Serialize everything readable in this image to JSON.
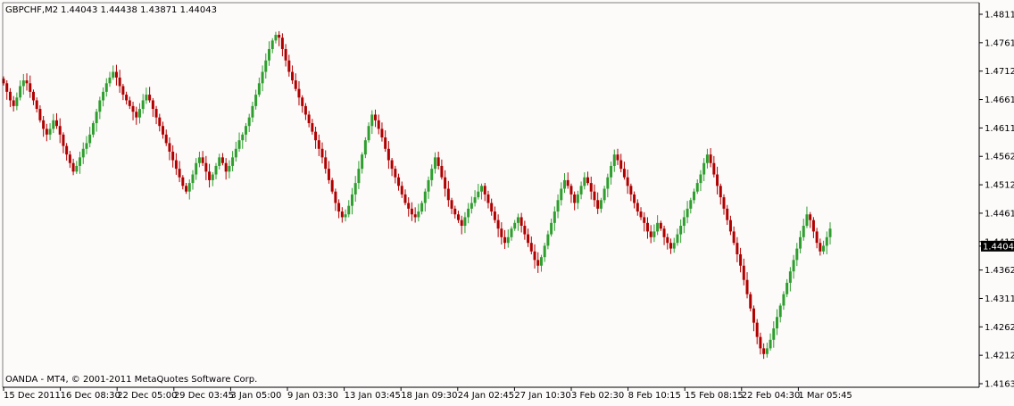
{
  "header": {
    "symbol": "GBPCHF,M2",
    "ohlc": "1.44043 1.44438 1.43871 1.44043"
  },
  "footer": {
    "copyright": "OANDA - MT4, © 2001-2011 MetaQuotes Software Corp."
  },
  "colors": {
    "background": "#fdfafa",
    "bull": "#2e9e2e",
    "bear": "#b00000",
    "axis": "#000000",
    "price_tag_bg": "#000000",
    "price_tag_fg": "#ffffff"
  },
  "chart_data": {
    "type": "candlestick",
    "title": "GBPCHF,M2",
    "last_price": "1.44043",
    "ylim": [
      1.4163,
      1.4811
    ],
    "y_ticks": [
      "1.48110",
      "1.47615",
      "1.47120",
      "1.46610",
      "1.46115",
      "1.45620",
      "1.45125",
      "1.44615",
      "1.44120",
      "1.43625",
      "1.43115",
      "1.42620",
      "1.42125",
      "1.41630"
    ],
    "x_ticks": [
      "15 Dec 2011",
      "16 Dec 08:30",
      "22 Dec 05:00",
      "29 Dec 03:45",
      "3 Jan 05:00",
      "9 Jan 03:30",
      "13 Jan 03:45",
      "18 Jan 09:30",
      "24 Jan 02:45",
      "27 Jan 10:30",
      "3 Feb 02:30",
      "8 Feb 10:15",
      "15 Feb 08:15",
      "22 Feb 04:30",
      "1 Mar 05:45"
    ],
    "close_series": [
      1.469,
      1.4675,
      1.466,
      1.465,
      1.4665,
      1.4685,
      1.4695,
      1.469,
      1.4675,
      1.466,
      1.4645,
      1.4625,
      1.461,
      1.46,
      1.461,
      1.4625,
      1.4615,
      1.46,
      1.458,
      1.4565,
      1.455,
      1.4535,
      1.4545,
      1.456,
      1.4575,
      1.4585,
      1.46,
      1.462,
      1.464,
      1.466,
      1.4675,
      1.469,
      1.47,
      1.471,
      1.47,
      1.4685,
      1.467,
      1.466,
      1.465,
      1.464,
      1.463,
      1.4645,
      1.466,
      1.467,
      1.466,
      1.4645,
      1.463,
      1.4615,
      1.46,
      1.4585,
      1.457,
      1.4555,
      1.454,
      1.4525,
      1.451,
      1.45,
      1.4515,
      1.453,
      1.455,
      1.456,
      1.455,
      1.4535,
      1.452,
      1.453,
      1.4545,
      1.456,
      1.455,
      1.4535,
      1.4545,
      1.456,
      1.4575,
      1.459,
      1.46,
      1.4615,
      1.463,
      1.465,
      1.467,
      1.469,
      1.471,
      1.473,
      1.475,
      1.4765,
      1.4775,
      1.477,
      1.475,
      1.473,
      1.471,
      1.4695,
      1.468,
      1.4665,
      1.465,
      1.4635,
      1.462,
      1.4605,
      1.459,
      1.4575,
      1.456,
      1.454,
      1.452,
      1.45,
      1.448,
      1.4465,
      1.4455,
      1.446,
      1.4475,
      1.4495,
      1.4515,
      1.454,
      1.4565,
      1.459,
      1.4615,
      1.4635,
      1.4625,
      1.461,
      1.4595,
      1.4575,
      1.4555,
      1.454,
      1.4525,
      1.451,
      1.4495,
      1.448,
      1.447,
      1.446,
      1.4455,
      1.4465,
      1.448,
      1.45,
      1.452,
      1.454,
      1.456,
      1.4545,
      1.4525,
      1.4505,
      1.4485,
      1.447,
      1.446,
      1.445,
      1.444,
      1.4455,
      1.447,
      1.448,
      1.449,
      1.45,
      1.451,
      1.4495,
      1.448,
      1.4465,
      1.445,
      1.4435,
      1.442,
      1.441,
      1.442,
      1.4435,
      1.4445,
      1.4455,
      1.444,
      1.4425,
      1.441,
      1.4395,
      1.438,
      1.437,
      1.4385,
      1.4405,
      1.4425,
      1.4445,
      1.4465,
      1.4485,
      1.4505,
      1.452,
      1.451,
      1.4495,
      1.448,
      1.4495,
      1.451,
      1.4525,
      1.4515,
      1.45,
      1.4485,
      1.447,
      1.4485,
      1.4505,
      1.4525,
      1.4545,
      1.4565,
      1.4555,
      1.454,
      1.4525,
      1.451,
      1.4495,
      1.448,
      1.4465,
      1.4455,
      1.4445,
      1.443,
      1.442,
      1.443,
      1.4445,
      1.4435,
      1.442,
      1.441,
      1.44,
      1.441,
      1.4425,
      1.444,
      1.4455,
      1.447,
      1.4485,
      1.45,
      1.4515,
      1.453,
      1.455,
      1.4565,
      1.455,
      1.453,
      1.451,
      1.449,
      1.447,
      1.445,
      1.443,
      1.441,
      1.439,
      1.437,
      1.4345,
      1.432,
      1.4295,
      1.427,
      1.4245,
      1.4225,
      1.4215,
      1.4225,
      1.424,
      1.426,
      1.428,
      1.43,
      1.432,
      1.434,
      1.436,
      1.438,
      1.44,
      1.442,
      1.444,
      1.446,
      1.445,
      1.443,
      1.441,
      1.4395,
      1.4405,
      1.442,
      1.4435
    ]
  }
}
